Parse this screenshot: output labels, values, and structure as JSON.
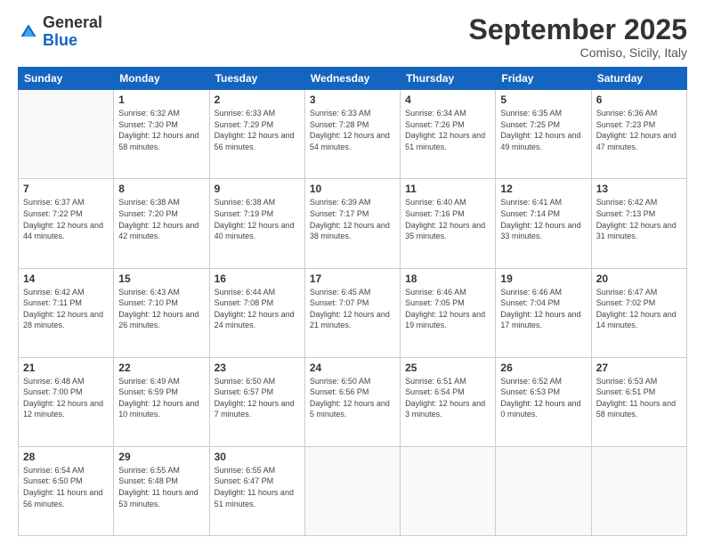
{
  "logo": {
    "general": "General",
    "blue": "Blue"
  },
  "header": {
    "month": "September 2025",
    "location": "Comiso, Sicily, Italy"
  },
  "weekdays": [
    "Sunday",
    "Monday",
    "Tuesday",
    "Wednesday",
    "Thursday",
    "Friday",
    "Saturday"
  ],
  "weeks": [
    [
      {
        "day": "",
        "sunrise": "",
        "sunset": "",
        "daylight": ""
      },
      {
        "day": "1",
        "sunrise": "Sunrise: 6:32 AM",
        "sunset": "Sunset: 7:30 PM",
        "daylight": "Daylight: 12 hours and 58 minutes."
      },
      {
        "day": "2",
        "sunrise": "Sunrise: 6:33 AM",
        "sunset": "Sunset: 7:29 PM",
        "daylight": "Daylight: 12 hours and 56 minutes."
      },
      {
        "day": "3",
        "sunrise": "Sunrise: 6:33 AM",
        "sunset": "Sunset: 7:28 PM",
        "daylight": "Daylight: 12 hours and 54 minutes."
      },
      {
        "day": "4",
        "sunrise": "Sunrise: 6:34 AM",
        "sunset": "Sunset: 7:26 PM",
        "daylight": "Daylight: 12 hours and 51 minutes."
      },
      {
        "day": "5",
        "sunrise": "Sunrise: 6:35 AM",
        "sunset": "Sunset: 7:25 PM",
        "daylight": "Daylight: 12 hours and 49 minutes."
      },
      {
        "day": "6",
        "sunrise": "Sunrise: 6:36 AM",
        "sunset": "Sunset: 7:23 PM",
        "daylight": "Daylight: 12 hours and 47 minutes."
      }
    ],
    [
      {
        "day": "7",
        "sunrise": "Sunrise: 6:37 AM",
        "sunset": "Sunset: 7:22 PM",
        "daylight": "Daylight: 12 hours and 44 minutes."
      },
      {
        "day": "8",
        "sunrise": "Sunrise: 6:38 AM",
        "sunset": "Sunset: 7:20 PM",
        "daylight": "Daylight: 12 hours and 42 minutes."
      },
      {
        "day": "9",
        "sunrise": "Sunrise: 6:38 AM",
        "sunset": "Sunset: 7:19 PM",
        "daylight": "Daylight: 12 hours and 40 minutes."
      },
      {
        "day": "10",
        "sunrise": "Sunrise: 6:39 AM",
        "sunset": "Sunset: 7:17 PM",
        "daylight": "Daylight: 12 hours and 38 minutes."
      },
      {
        "day": "11",
        "sunrise": "Sunrise: 6:40 AM",
        "sunset": "Sunset: 7:16 PM",
        "daylight": "Daylight: 12 hours and 35 minutes."
      },
      {
        "day": "12",
        "sunrise": "Sunrise: 6:41 AM",
        "sunset": "Sunset: 7:14 PM",
        "daylight": "Daylight: 12 hours and 33 minutes."
      },
      {
        "day": "13",
        "sunrise": "Sunrise: 6:42 AM",
        "sunset": "Sunset: 7:13 PM",
        "daylight": "Daylight: 12 hours and 31 minutes."
      }
    ],
    [
      {
        "day": "14",
        "sunrise": "Sunrise: 6:42 AM",
        "sunset": "Sunset: 7:11 PM",
        "daylight": "Daylight: 12 hours and 28 minutes."
      },
      {
        "day": "15",
        "sunrise": "Sunrise: 6:43 AM",
        "sunset": "Sunset: 7:10 PM",
        "daylight": "Daylight: 12 hours and 26 minutes."
      },
      {
        "day": "16",
        "sunrise": "Sunrise: 6:44 AM",
        "sunset": "Sunset: 7:08 PM",
        "daylight": "Daylight: 12 hours and 24 minutes."
      },
      {
        "day": "17",
        "sunrise": "Sunrise: 6:45 AM",
        "sunset": "Sunset: 7:07 PM",
        "daylight": "Daylight: 12 hours and 21 minutes."
      },
      {
        "day": "18",
        "sunrise": "Sunrise: 6:46 AM",
        "sunset": "Sunset: 7:05 PM",
        "daylight": "Daylight: 12 hours and 19 minutes."
      },
      {
        "day": "19",
        "sunrise": "Sunrise: 6:46 AM",
        "sunset": "Sunset: 7:04 PM",
        "daylight": "Daylight: 12 hours and 17 minutes."
      },
      {
        "day": "20",
        "sunrise": "Sunrise: 6:47 AM",
        "sunset": "Sunset: 7:02 PM",
        "daylight": "Daylight: 12 hours and 14 minutes."
      }
    ],
    [
      {
        "day": "21",
        "sunrise": "Sunrise: 6:48 AM",
        "sunset": "Sunset: 7:00 PM",
        "daylight": "Daylight: 12 hours and 12 minutes."
      },
      {
        "day": "22",
        "sunrise": "Sunrise: 6:49 AM",
        "sunset": "Sunset: 6:59 PM",
        "daylight": "Daylight: 12 hours and 10 minutes."
      },
      {
        "day": "23",
        "sunrise": "Sunrise: 6:50 AM",
        "sunset": "Sunset: 6:57 PM",
        "daylight": "Daylight: 12 hours and 7 minutes."
      },
      {
        "day": "24",
        "sunrise": "Sunrise: 6:50 AM",
        "sunset": "Sunset: 6:56 PM",
        "daylight": "Daylight: 12 hours and 5 minutes."
      },
      {
        "day": "25",
        "sunrise": "Sunrise: 6:51 AM",
        "sunset": "Sunset: 6:54 PM",
        "daylight": "Daylight: 12 hours and 3 minutes."
      },
      {
        "day": "26",
        "sunrise": "Sunrise: 6:52 AM",
        "sunset": "Sunset: 6:53 PM",
        "daylight": "Daylight: 12 hours and 0 minutes."
      },
      {
        "day": "27",
        "sunrise": "Sunrise: 6:53 AM",
        "sunset": "Sunset: 6:51 PM",
        "daylight": "Daylight: 11 hours and 58 minutes."
      }
    ],
    [
      {
        "day": "28",
        "sunrise": "Sunrise: 6:54 AM",
        "sunset": "Sunset: 6:50 PM",
        "daylight": "Daylight: 11 hours and 56 minutes."
      },
      {
        "day": "29",
        "sunrise": "Sunrise: 6:55 AM",
        "sunset": "Sunset: 6:48 PM",
        "daylight": "Daylight: 11 hours and 53 minutes."
      },
      {
        "day": "30",
        "sunrise": "Sunrise: 6:55 AM",
        "sunset": "Sunset: 6:47 PM",
        "daylight": "Daylight: 11 hours and 51 minutes."
      },
      {
        "day": "",
        "sunrise": "",
        "sunset": "",
        "daylight": ""
      },
      {
        "day": "",
        "sunrise": "",
        "sunset": "",
        "daylight": ""
      },
      {
        "day": "",
        "sunrise": "",
        "sunset": "",
        "daylight": ""
      },
      {
        "day": "",
        "sunrise": "",
        "sunset": "",
        "daylight": ""
      }
    ]
  ]
}
